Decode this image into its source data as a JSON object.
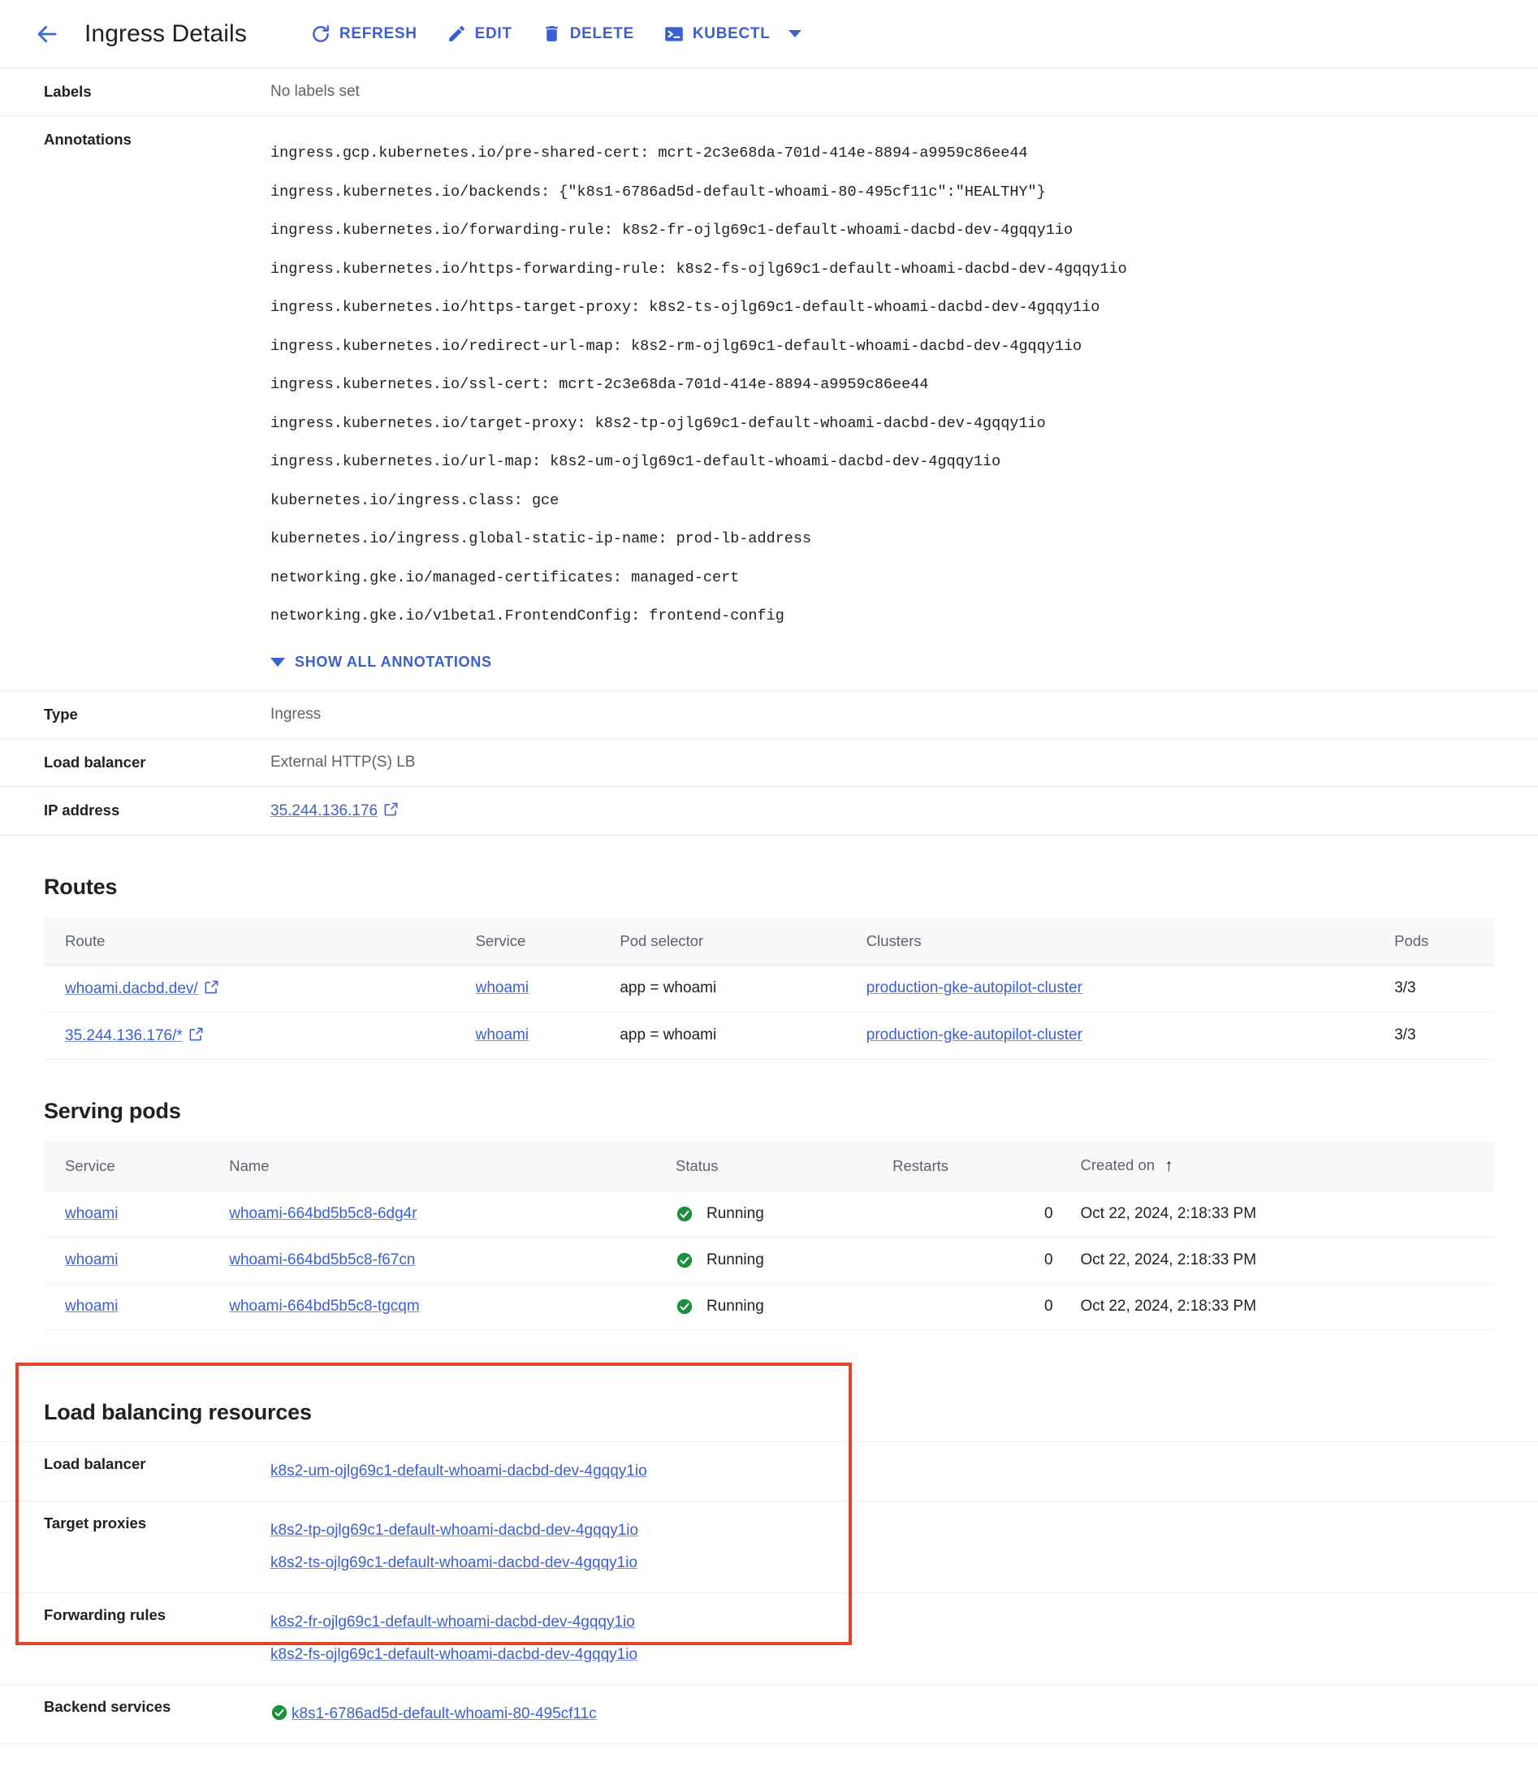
{
  "toolbar": {
    "back_icon": "arrow-left-icon",
    "title": "Ingress Details",
    "buttons": [
      {
        "label": "REFRESH",
        "icon": "refresh-icon"
      },
      {
        "label": "EDIT",
        "icon": "pencil-icon"
      },
      {
        "label": "DELETE",
        "icon": "trash-icon"
      },
      {
        "label": "KUBECTL",
        "icon": "terminal-icon",
        "has_dropdown": true
      }
    ]
  },
  "details": {
    "labels": {
      "key": "Labels",
      "value": "No labels set"
    },
    "annotations": {
      "key": "Annotations",
      "lines": [
        "ingress.gcp.kubernetes.io/pre-shared-cert: mcrt-2c3e68da-701d-414e-8894-a9959c86ee44",
        "ingress.kubernetes.io/backends: {\"k8s1-6786ad5d-default-whoami-80-495cf11c\":\"HEALTHY\"}",
        "ingress.kubernetes.io/forwarding-rule: k8s2-fr-ojlg69c1-default-whoami-dacbd-dev-4gqqy1io",
        "ingress.kubernetes.io/https-forwarding-rule: k8s2-fs-ojlg69c1-default-whoami-dacbd-dev-4gqqy1io",
        "ingress.kubernetes.io/https-target-proxy: k8s2-ts-ojlg69c1-default-whoami-dacbd-dev-4gqqy1io",
        "ingress.kubernetes.io/redirect-url-map: k8s2-rm-ojlg69c1-default-whoami-dacbd-dev-4gqqy1io",
        "ingress.kubernetes.io/ssl-cert: mcrt-2c3e68da-701d-414e-8894-a9959c86ee44",
        "ingress.kubernetes.io/target-proxy: k8s2-tp-ojlg69c1-default-whoami-dacbd-dev-4gqqy1io",
        "ingress.kubernetes.io/url-map: k8s2-um-ojlg69c1-default-whoami-dacbd-dev-4gqqy1io",
        "kubernetes.io/ingress.class: gce",
        "kubernetes.io/ingress.global-static-ip-name: prod-lb-address",
        "networking.gke.io/managed-certificates: managed-cert",
        "networking.gke.io/v1beta1.FrontendConfig: frontend-config"
      ],
      "show_all_label": "SHOW ALL ANNOTATIONS"
    },
    "type": {
      "key": "Type",
      "value": "Ingress"
    },
    "load_balancer": {
      "key": "Load balancer",
      "value": "External HTTP(S) LB"
    },
    "ip_address": {
      "key": "IP address",
      "value": "35.244.136.176"
    }
  },
  "routes": {
    "title": "Routes",
    "columns": [
      "Route",
      "Service",
      "Pod selector",
      "Clusters",
      "Pods"
    ],
    "rows": [
      {
        "route": "whoami.dacbd.dev/",
        "service": "whoami",
        "pod_selector": "app = whoami",
        "cluster": "production-gke-autopilot-cluster",
        "pods": "3/3"
      },
      {
        "route": "35.244.136.176/*",
        "service": "whoami",
        "pod_selector": "app = whoami",
        "cluster": "production-gke-autopilot-cluster",
        "pods": "3/3"
      }
    ]
  },
  "serving_pods": {
    "title": "Serving pods",
    "columns": [
      "Service",
      "Name",
      "Status",
      "Restarts",
      "Created on"
    ],
    "sort_column": "Created on",
    "sort_direction": "ascending",
    "rows": [
      {
        "service": "whoami",
        "name": "whoami-664bd5b5c8-6dg4r",
        "status": "Running",
        "restarts": "0",
        "created_on": "Oct 22, 2024, 2:18:33 PM"
      },
      {
        "service": "whoami",
        "name": "whoami-664bd5b5c8-f67cn",
        "status": "Running",
        "restarts": "0",
        "created_on": "Oct 22, 2024, 2:18:33 PM"
      },
      {
        "service": "whoami",
        "name": "whoami-664bd5b5c8-tgcqm",
        "status": "Running",
        "restarts": "0",
        "created_on": "Oct 22, 2024, 2:18:33 PM"
      }
    ]
  },
  "load_balancing_resources": {
    "title": "Load balancing resources",
    "highlighted": true,
    "rows": [
      {
        "key": "Load balancer",
        "values": [
          "k8s2-um-ojlg69c1-default-whoami-dacbd-dev-4gqqy1io"
        ],
        "status_icon": false
      },
      {
        "key": "Target proxies",
        "values": [
          "k8s2-tp-ojlg69c1-default-whoami-dacbd-dev-4gqqy1io",
          "k8s2-ts-ojlg69c1-default-whoami-dacbd-dev-4gqqy1io"
        ],
        "status_icon": false
      },
      {
        "key": "Forwarding rules",
        "values": [
          "k8s2-fr-ojlg69c1-default-whoami-dacbd-dev-4gqqy1io",
          "k8s2-fs-ojlg69c1-default-whoami-dacbd-dev-4gqqy1io"
        ],
        "status_icon": false
      },
      {
        "key": "Backend services",
        "values": [
          "k8s1-6786ad5d-default-whoami-80-495cf11c"
        ],
        "status_icon": true
      }
    ]
  },
  "colors": {
    "accent_blue": "#3c5fd0",
    "link_blue": "#3c5fd0",
    "status_green": "#1e8e3e",
    "highlight_red": "#e0442b",
    "muted_text": "#5f6368",
    "border": "#e8eaed",
    "header_bg": "#f7f8f9"
  }
}
